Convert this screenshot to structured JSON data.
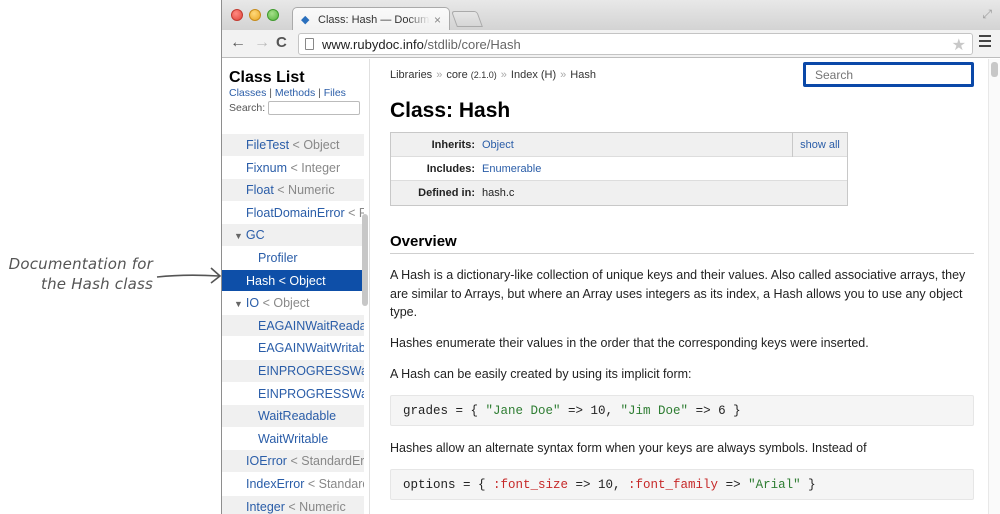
{
  "annotation": {
    "line1": "Documentation for",
    "line2": "the Hash class"
  },
  "browser": {
    "tab_title": "Class: Hash — Documentation",
    "tab_close": "×",
    "url_host": "www.rubydoc.info",
    "url_path": "/stdlib/core/Hash",
    "back": "←",
    "forward": "→",
    "reload": "C",
    "star": "★",
    "fullscreen": "⤢"
  },
  "sidebar": {
    "title": "Class List",
    "links": [
      "Classes",
      "Methods",
      "Files"
    ],
    "link_sep": " | ",
    "search_label": "Search:",
    "items": [
      {
        "name": "FileTest",
        "super": " < Object",
        "level": 1
      },
      {
        "name": "Fixnum",
        "super": " < Integer",
        "level": 1
      },
      {
        "name": "Float",
        "super": " < Numeric",
        "level": 1
      },
      {
        "name": "FloatDomainError",
        "super": " < RangeError",
        "level": 1
      },
      {
        "name": "GC",
        "super": "",
        "level": 0,
        "expanded": true
      },
      {
        "name": "Profiler",
        "super": "",
        "level": 2
      },
      {
        "name": "Hash",
        "super": " < Object",
        "level": 1,
        "selected": true
      },
      {
        "name": "IO",
        "super": " < Object",
        "level": 0,
        "expanded": true
      },
      {
        "name": "EAGAINWaitReadable",
        "super": "",
        "level": 2
      },
      {
        "name": "EAGAINWaitWritable",
        "super": "",
        "level": 2
      },
      {
        "name": "EINPROGRESSWaitReadable",
        "super": "",
        "level": 2
      },
      {
        "name": "EINPROGRESSWaitWritable",
        "super": "",
        "level": 2
      },
      {
        "name": "WaitReadable",
        "super": "",
        "level": 2
      },
      {
        "name": "WaitWritable",
        "super": "",
        "level": 2
      },
      {
        "name": "IOError",
        "super": " < StandardError",
        "level": 1
      },
      {
        "name": "IndexError",
        "super": " < StandardError",
        "level": 1
      },
      {
        "name": "Integer",
        "super": " < Numeric",
        "level": 1
      }
    ]
  },
  "main": {
    "breadcrumb": {
      "libraries": "Libraries",
      "sep": "»",
      "core": "core",
      "core_version": "(2.1.0)",
      "index": "Index (H)",
      "current": "Hash"
    },
    "search_placeholder": "Search",
    "title": "Class: Hash",
    "info": {
      "inherits_label": "Inherits:",
      "inherits_value": "Object",
      "show_all": "show all",
      "includes_label": "Includes:",
      "includes_value": "Enumerable",
      "defined_label": "Defined in:",
      "defined_value": "hash.c"
    },
    "overview_heading": "Overview",
    "paragraphs": [
      "A Hash is a dictionary-like collection of unique keys and their values. Also called associative arrays, they are similar to Arrays, but where an Array uses integers as its index, a Hash allows you to use any object type.",
      "Hashes enumerate their values in the order that the corresponding keys were inserted.",
      "A Hash can be easily created by using its implicit form:",
      "Hashes allow an alternate syntax form when your keys are always symbols. Instead of"
    ],
    "code1": {
      "a": "grades = { ",
      "s1": "\"Jane Doe\"",
      "b": " => 10, ",
      "s2": "\"Jim Doe\"",
      "c": " => 6 }"
    },
    "code2": {
      "a": "options = { ",
      "k1": ":font_size",
      "b": " => 10, ",
      "k2": ":font_family",
      "c": " => ",
      "s1": "\"Arial\"",
      "d": " }"
    }
  }
}
